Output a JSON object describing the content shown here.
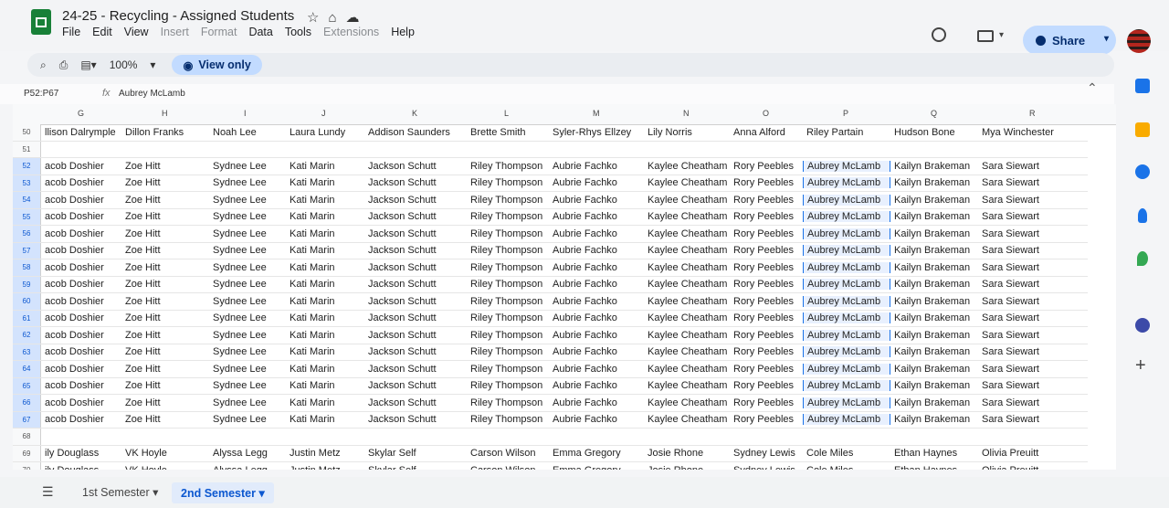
{
  "title": "24-25 - Recycling - Assigned Students",
  "title_icons": [
    "star-icon",
    "move-icon",
    "cloud-icon"
  ],
  "menu": [
    "File",
    "Edit",
    "View",
    "Insert",
    "Format",
    "Data",
    "Tools",
    "Extensions",
    "Help"
  ],
  "menu_dim": [
    false,
    false,
    false,
    true,
    true,
    false,
    false,
    true,
    false
  ],
  "toolbar": {
    "zoom": "100%",
    "view_only": "View only"
  },
  "share": {
    "label": "Share"
  },
  "namebox": "P52:P67",
  "formula": "Aubrey McLamb",
  "columns": [
    "G",
    "H",
    "I",
    "J",
    "K",
    "L",
    "M",
    "N",
    "O",
    "P",
    "Q",
    "R"
  ],
  "row50": [
    "llison Dalrymple",
    "Dillon Franks",
    "Noah Lee",
    "Laura Lundy",
    "Addison Saunders",
    "Brette Smith",
    "Syler-Rhys Ellzey",
    "Lily Norris",
    "Anna Alford",
    "Riley Partain",
    "Hudson Bone",
    "Mya Winchester"
  ],
  "assigned": [
    "acob Doshier",
    "Zoe Hitt",
    "Sydnee Lee",
    "Kati Marin",
    "Jackson Schutt",
    "Riley Thompson",
    "Aubrie Fachko",
    "Kaylee Cheatham",
    "Rory Peebles",
    "Aubrey McLamb",
    "Kailyn Brakeman",
    "Sara Siewart"
  ],
  "row_last": [
    "ily Douglass",
    "VK Hoyle",
    "Alyssa Legg",
    "Justin Metz",
    "Skylar Self",
    "Carson Wilson",
    "Emma Gregory",
    "Josie Rhone",
    "Sydney Lewis",
    "Cole Miles",
    "Ethan Haynes",
    "Olivia Preuitt"
  ],
  "rows": [
    {
      "num": "50",
      "type": "row50"
    },
    {
      "num": "51",
      "type": "empty"
    },
    {
      "num": "52",
      "type": "assigned"
    },
    {
      "num": "53",
      "type": "assigned"
    },
    {
      "num": "54",
      "type": "assigned"
    },
    {
      "num": "55",
      "type": "assigned"
    },
    {
      "num": "56",
      "type": "assigned"
    },
    {
      "num": "57",
      "type": "assigned"
    },
    {
      "num": "58",
      "type": "assigned"
    },
    {
      "num": "59",
      "type": "assigned"
    },
    {
      "num": "60",
      "type": "assigned"
    },
    {
      "num": "61",
      "type": "assigned"
    },
    {
      "num": "62",
      "type": "assigned"
    },
    {
      "num": "63",
      "type": "assigned"
    },
    {
      "num": "64",
      "type": "assigned"
    },
    {
      "num": "65",
      "type": "assigned"
    },
    {
      "num": "66",
      "type": "assigned"
    },
    {
      "num": "67",
      "type": "assigned"
    },
    {
      "num": "68",
      "type": "empty"
    },
    {
      "num": "69",
      "type": "row_last"
    },
    {
      "num": "70",
      "type": "row_last"
    }
  ],
  "tabs": [
    "1st Semester",
    "2nd Semester"
  ],
  "active_tab": "2nd Semester"
}
